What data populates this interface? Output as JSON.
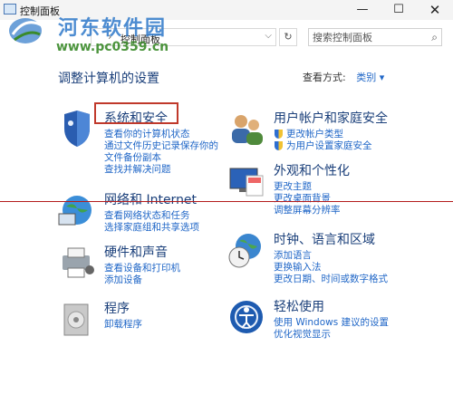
{
  "window": {
    "title": "控制面板",
    "minimize": "—",
    "maximize": "☐",
    "close": "✕"
  },
  "watermark": {
    "line1": "河东软件园",
    "line2": "www.pc0359.cn"
  },
  "address": {
    "breadcrumb": "控制面板",
    "separator": "›",
    "dropdown": "⌵",
    "refresh": "↻"
  },
  "search": {
    "placeholder": "搜索控制面板",
    "icon": "search-icon"
  },
  "heading": "调整计算机的设置",
  "view": {
    "label": "查看方式:",
    "value": "类别 ▾"
  },
  "categories": {
    "system": {
      "title": "系统和安全",
      "links": [
        "查看你的计算机状态",
        "通过文件历史记录保存你的",
        "文件备份副本",
        "查找并解决问题"
      ]
    },
    "network": {
      "title": "网络和 Internet",
      "links": [
        "查看网络状态和任务",
        "选择家庭组和共享选项"
      ]
    },
    "hardware": {
      "title": "硬件和声音",
      "links": [
        "查看设备和打印机",
        "添加设备"
      ]
    },
    "programs": {
      "title": "程序",
      "links": [
        "卸载程序"
      ]
    },
    "users": {
      "title": "用户帐户和家庭安全",
      "links": [
        "更改帐户类型",
        "为用户设置家庭安全"
      ]
    },
    "appearance": {
      "title": "外观和个性化",
      "links": [
        "更改主题",
        "更改桌面背景",
        "调整屏幕分辨率"
      ]
    },
    "clock": {
      "title": "时钟、语言和区域",
      "links": [
        "添加语言",
        "更换输入法",
        "更改日期、时间或数字格式"
      ]
    },
    "ease": {
      "title": "轻松使用",
      "links": [
        "使用 Windows 建议的设置",
        "优化视觉显示"
      ]
    }
  },
  "colors": {
    "accent": "#1f66c7",
    "heading": "#1a3f7a",
    "highlight": "#c0392b"
  }
}
